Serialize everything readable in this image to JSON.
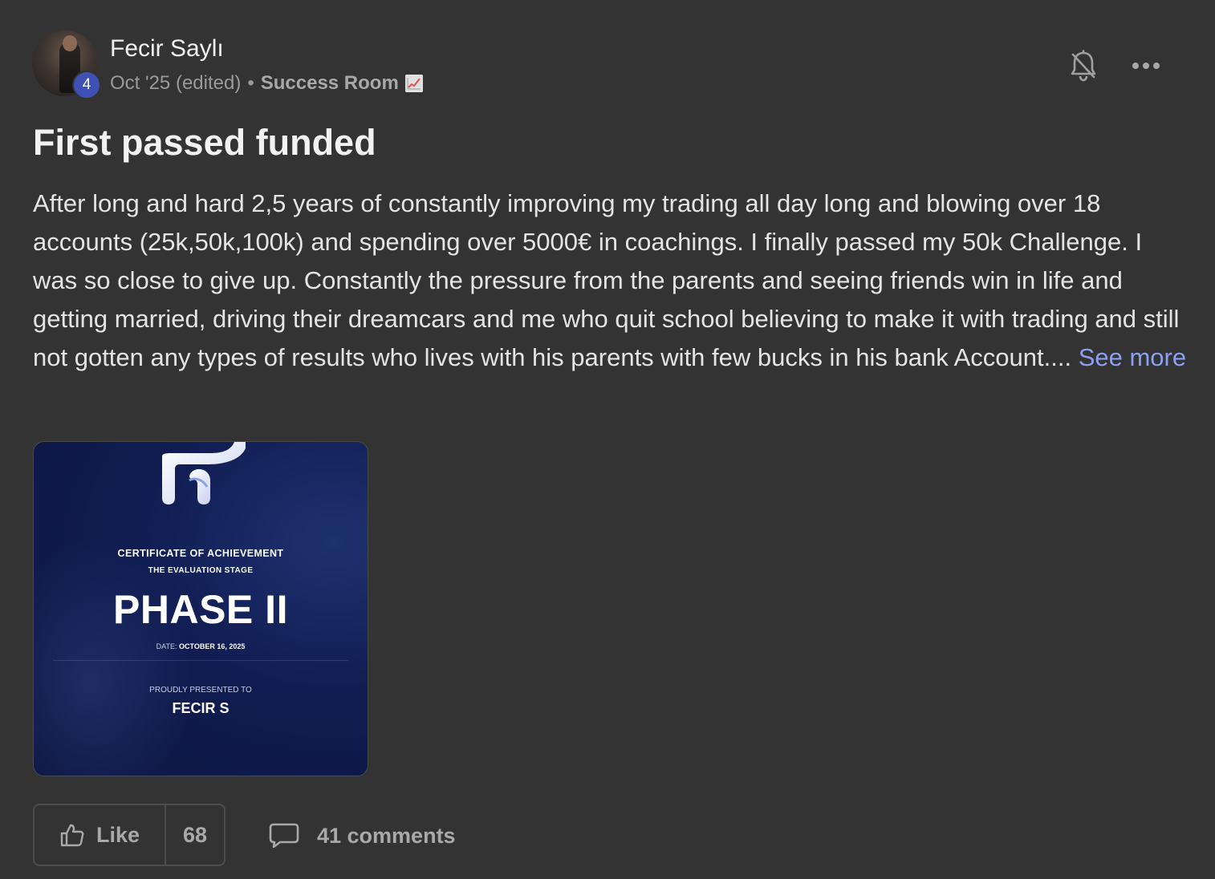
{
  "post": {
    "author": {
      "name": "Fecir Saylı",
      "level": "4"
    },
    "meta": {
      "date": "Oct '25 (edited)",
      "separator": "•",
      "category": "Success Room",
      "category_emoji": "chart-increasing-icon"
    },
    "title": "First passed funded",
    "body": "After long and hard 2,5 years of constantly improving my trading all day long and blowing over 18 accounts (25k,50k,100k) and spending over 5000€ in coachings. I finally passed my 50k Challenge. I was so close to give up. Constantly the pressure from the parents and seeing friends win in life and getting married, driving their dreamcars and me who quit school believing to make it with trading and still not gotten any types of results who lives with his parents with few bucks in his bank Account....",
    "see_more": "See more",
    "attachment": {
      "line1": "CERTIFICATE OF ACHIEVEMENT",
      "line2": "THE EVALUATION STAGE",
      "phase": "PHASE II",
      "date_label": "DATE:",
      "date_value": "OCTOBER 16, 2025",
      "presented_label": "PROUDLY PRESENTED TO",
      "recipient": "FECIR S"
    },
    "footer": {
      "like_label": "Like",
      "like_count": "68",
      "comments_label": "41 comments"
    }
  },
  "icons": {
    "notification": "bell-off-icon",
    "more": "more-horizontal-icon",
    "like": "thumbs-up-icon",
    "comments": "comment-icon"
  },
  "colors": {
    "background": "#333333",
    "link": "#8c9ff0",
    "badge": "#3f51b5",
    "certificate_bg": "#111d52"
  }
}
